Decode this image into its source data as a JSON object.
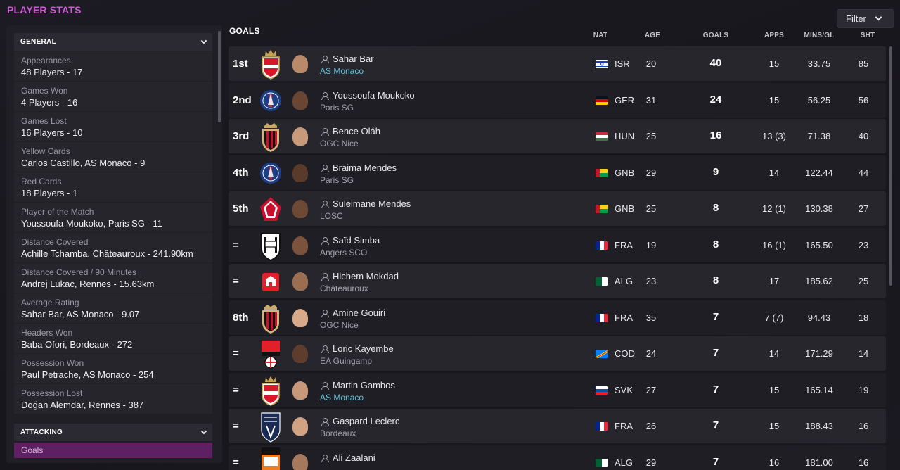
{
  "page": {
    "title": "PLAYER STATS",
    "filter_label": "Filter"
  },
  "sidebar": {
    "general_title": "GENERAL",
    "items": [
      {
        "category": "Appearances",
        "value": "48 Players - 17"
      },
      {
        "category": "Games Won",
        "value": "4 Players - 16"
      },
      {
        "category": "Games Lost",
        "value": "16 Players - 10"
      },
      {
        "category": "Yellow Cards",
        "value": "Carlos Castillo, AS Monaco - 9"
      },
      {
        "category": "Red Cards",
        "value": "18 Players - 1"
      },
      {
        "category": "Player of the Match",
        "value": "Youssoufa Moukoko, Paris SG - 11"
      },
      {
        "category": "Distance Covered",
        "value": "Achille Tchamba, Châteauroux - 241.90km"
      },
      {
        "category": "Distance Covered / 90 Minutes",
        "value": "Andrej Lukac, Rennes - 15.63km"
      },
      {
        "category": "Average Rating",
        "value": "Sahar Bar, AS Monaco - 9.07"
      },
      {
        "category": "Headers Won",
        "value": "Baba Ofori, Bordeaux - 272"
      },
      {
        "category": "Possession Won",
        "value": "Paul Petrache, AS Monaco - 254"
      },
      {
        "category": "Possession Lost",
        "value": "Doğan Alemdar, Rennes - 387"
      }
    ],
    "attacking_title": "ATTACKING",
    "selected_item": "Goals"
  },
  "table": {
    "title": "GOALS",
    "columns": {
      "nat": "NAT",
      "age": "AGE",
      "goals": "GOALS",
      "apps": "APPS",
      "mins_gl": "MINS/GL",
      "sht": "SHT"
    },
    "rows": [
      {
        "pos": "1st",
        "name": "Sahar Bar",
        "club": "AS Monaco",
        "club_link": true,
        "crest": "monaco",
        "flag": "isr",
        "nat": "ISR",
        "age": "20",
        "goals": "40",
        "apps": "15",
        "mins": "33.75",
        "sht": "85"
      },
      {
        "pos": "2nd",
        "name": "Youssoufa Moukoko",
        "club": "Paris SG",
        "club_link": false,
        "crest": "psg",
        "flag": "ger",
        "nat": "GER",
        "age": "31",
        "goals": "24",
        "apps": "15",
        "mins": "56.25",
        "sht": "56"
      },
      {
        "pos": "3rd",
        "name": "Bence Oláh",
        "club": "OGC Nice",
        "club_link": false,
        "crest": "nice",
        "flag": "hun",
        "nat": "HUN",
        "age": "25",
        "goals": "16",
        "apps": "13 (3)",
        "mins": "71.38",
        "sht": "40"
      },
      {
        "pos": "4th",
        "name": "Braima Mendes",
        "club": "Paris SG",
        "club_link": false,
        "crest": "psg",
        "flag": "gnb",
        "nat": "GNB",
        "age": "29",
        "goals": "9",
        "apps": "14",
        "mins": "122.44",
        "sht": "44"
      },
      {
        "pos": "5th",
        "name": "Suleimane Mendes",
        "club": "LOSC",
        "club_link": false,
        "crest": "losc",
        "flag": "gnb",
        "nat": "GNB",
        "age": "25",
        "goals": "8",
        "apps": "12 (1)",
        "mins": "130.38",
        "sht": "27"
      },
      {
        "pos": "=",
        "name": "Saïd Simba",
        "club": "Angers SCO",
        "club_link": false,
        "crest": "angers",
        "flag": "fra",
        "nat": "FRA",
        "age": "19",
        "goals": "8",
        "apps": "16 (1)",
        "mins": "165.50",
        "sht": "23"
      },
      {
        "pos": "=",
        "name": "Hichem Mokdad",
        "club": "Châteauroux",
        "club_link": false,
        "crest": "chateauroux",
        "flag": "alg",
        "nat": "ALG",
        "age": "23",
        "goals": "8",
        "apps": "17",
        "mins": "185.62",
        "sht": "25"
      },
      {
        "pos": "8th",
        "name": "Amine Gouiri",
        "club": "OGC Nice",
        "club_link": false,
        "crest": "nice",
        "flag": "fra",
        "nat": "FRA",
        "age": "35",
        "goals": "7",
        "apps": "7 (7)",
        "mins": "94.43",
        "sht": "18"
      },
      {
        "pos": "=",
        "name": "Loric Kayembe",
        "club": "EA Guingamp",
        "club_link": false,
        "crest": "eag",
        "flag": "cod",
        "nat": "COD",
        "age": "24",
        "goals": "7",
        "apps": "14",
        "mins": "171.29",
        "sht": "14"
      },
      {
        "pos": "=",
        "name": "Martin Gambos",
        "club": "AS Monaco",
        "club_link": true,
        "crest": "monaco",
        "flag": "svk",
        "nat": "SVK",
        "age": "27",
        "goals": "7",
        "apps": "15",
        "mins": "165.14",
        "sht": "19"
      },
      {
        "pos": "=",
        "name": "Gaspard Leclerc",
        "club": "Bordeaux",
        "club_link": false,
        "crest": "bordeaux",
        "flag": "fra",
        "nat": "FRA",
        "age": "26",
        "goals": "7",
        "apps": "15",
        "mins": "188.43",
        "sht": "16"
      },
      {
        "pos": "=",
        "name": "Ali Zaalani",
        "club": "",
        "club_link": false,
        "crest": "lorient",
        "flag": "alg",
        "nat": "ALG",
        "age": "29",
        "goals": "7",
        "apps": "16",
        "mins": "181.00",
        "sht": "16"
      }
    ]
  },
  "colors": {
    "accent": "#d35bd8",
    "link": "#5fc3d8",
    "selected": "#5f1f63"
  }
}
